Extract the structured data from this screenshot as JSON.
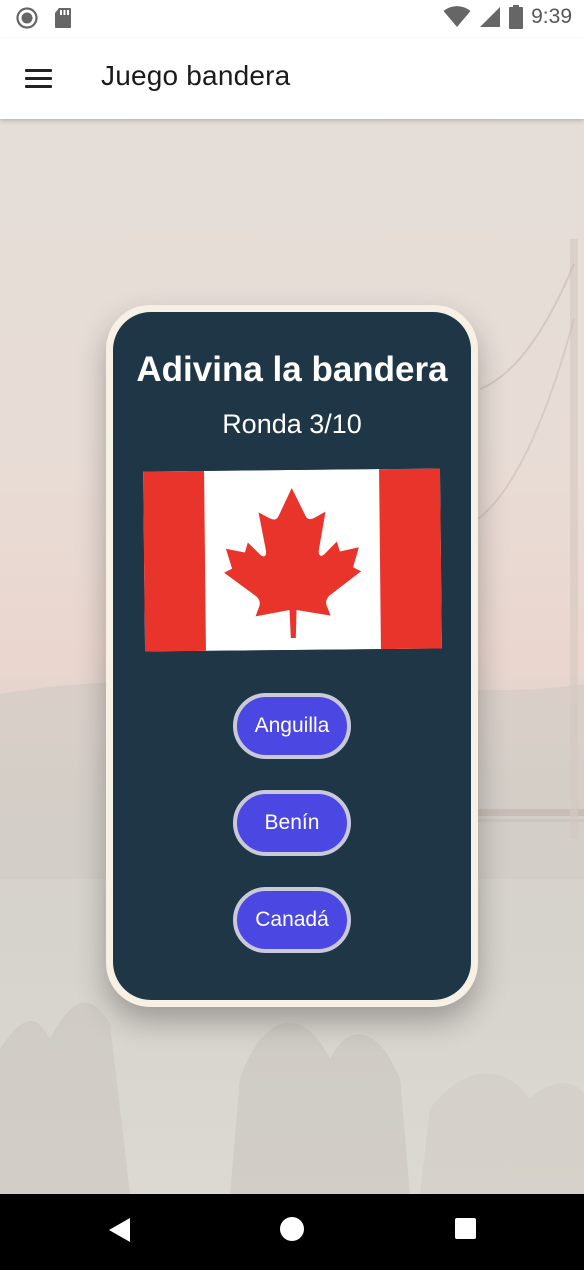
{
  "status_bar": {
    "time": "9:39",
    "icons": [
      "record-icon",
      "sd-card-icon",
      "wifi-icon",
      "signal-icon",
      "battery-icon"
    ]
  },
  "app_bar": {
    "title": "Juego bandera",
    "menu_icon": "hamburger-menu-icon"
  },
  "game": {
    "title": "Adivina la bandera",
    "round": "Ronda 3/10",
    "flag": "canada-flag",
    "options": [
      "Anguilla",
      "Benín",
      "Canadá"
    ]
  },
  "colors": {
    "card_background": "#1e3645",
    "card_border": "#f7f0e5",
    "button_background": "#4a47e3",
    "button_border": "#c9c9d9",
    "flag_red": "#e8342a"
  },
  "nav_bar": {
    "icons": [
      "back-icon",
      "home-icon",
      "recents-icon"
    ]
  }
}
